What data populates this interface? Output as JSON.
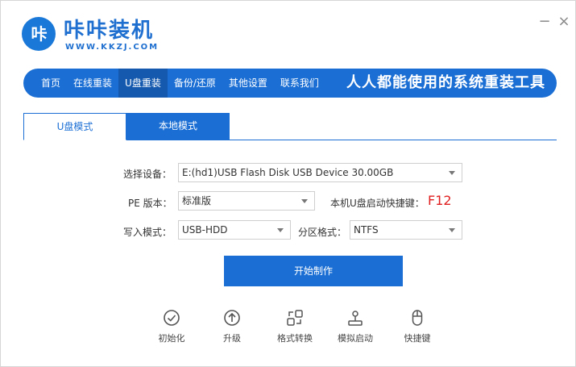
{
  "app": {
    "logo_text": "咔",
    "title": "咔咔装机",
    "url": "WWW.KKZJ.COM"
  },
  "window_controls": {
    "minimize": "−",
    "close": "×"
  },
  "nav": {
    "items": [
      {
        "label": "首页"
      },
      {
        "label": "在线重装"
      },
      {
        "label": "U盘重装"
      },
      {
        "label": "备份/还原"
      },
      {
        "label": "其他设置"
      },
      {
        "label": "联系我们"
      }
    ],
    "active_index": 2,
    "slogan": "人人都能使用的系统重装工具"
  },
  "tabs": [
    {
      "label": "U盘模式",
      "active": true
    },
    {
      "label": "本地模式",
      "active": false
    }
  ],
  "form": {
    "device_label": "选择设备：",
    "device_value": "E:(hd1)USB Flash Disk USB Device 30.00GB",
    "pe_label": "PE 版本：",
    "pe_value": "标准版",
    "hotkey_label": "本机U盘启动快捷键：",
    "hotkey_value": "F12",
    "write_label": "写入模式：",
    "write_value": "USB-HDD",
    "partition_label": "分区格式：",
    "partition_value": "NTFS"
  },
  "start_button": "开始制作",
  "tools": [
    {
      "label": "初始化",
      "icon": "check-circle-icon"
    },
    {
      "label": "升级",
      "icon": "upgrade-arrow-icon"
    },
    {
      "label": "格式转换",
      "icon": "format-convert-icon"
    },
    {
      "label": "模拟启动",
      "icon": "joystick-icon"
    },
    {
      "label": "快捷键",
      "icon": "mouse-icon"
    }
  ],
  "colors": {
    "brand": "#1b6fd4",
    "nav_active": "#1459ad",
    "hotkey": "#e02020"
  }
}
